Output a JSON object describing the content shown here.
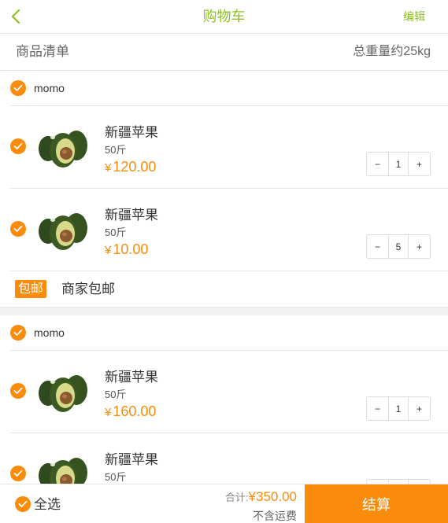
{
  "header": {
    "title": "购物车",
    "edit_label": "编辑",
    "back_icon": "chevron-left-icon"
  },
  "summary": {
    "list_label": "商品清单",
    "total_weight": "总重量约25kg"
  },
  "groups": [
    {
      "shop_name": "momo",
      "items": [
        {
          "name": "新疆苹果",
          "spec": "50斤",
          "currency": "¥",
          "price": "120.00",
          "qty": "1"
        },
        {
          "name": "新疆苹果",
          "spec": "50斤",
          "currency": "¥",
          "price": "10.00",
          "qty": "5"
        }
      ],
      "shipping_badge": "包邮",
      "shipping_label": "商家包邮"
    },
    {
      "shop_name": "momo",
      "items": [
        {
          "name": "新疆苹果",
          "spec": "50斤",
          "currency": "¥",
          "price": "160.00",
          "qty": "1"
        },
        {
          "name": "新疆苹果",
          "spec": "50斤",
          "currency": "¥",
          "price": "",
          "qty": ""
        }
      ]
    }
  ],
  "stepper": {
    "minus": "−",
    "plus": "+"
  },
  "footer": {
    "select_all": "全选",
    "total_label": "合计:",
    "total_amount": "¥350.00",
    "shipping_note": "不含运费",
    "checkout_label": "结算"
  },
  "colors": {
    "accent": "#fb8b0b",
    "title_green": "#8dc21f",
    "divider": "#e6e6e6"
  }
}
